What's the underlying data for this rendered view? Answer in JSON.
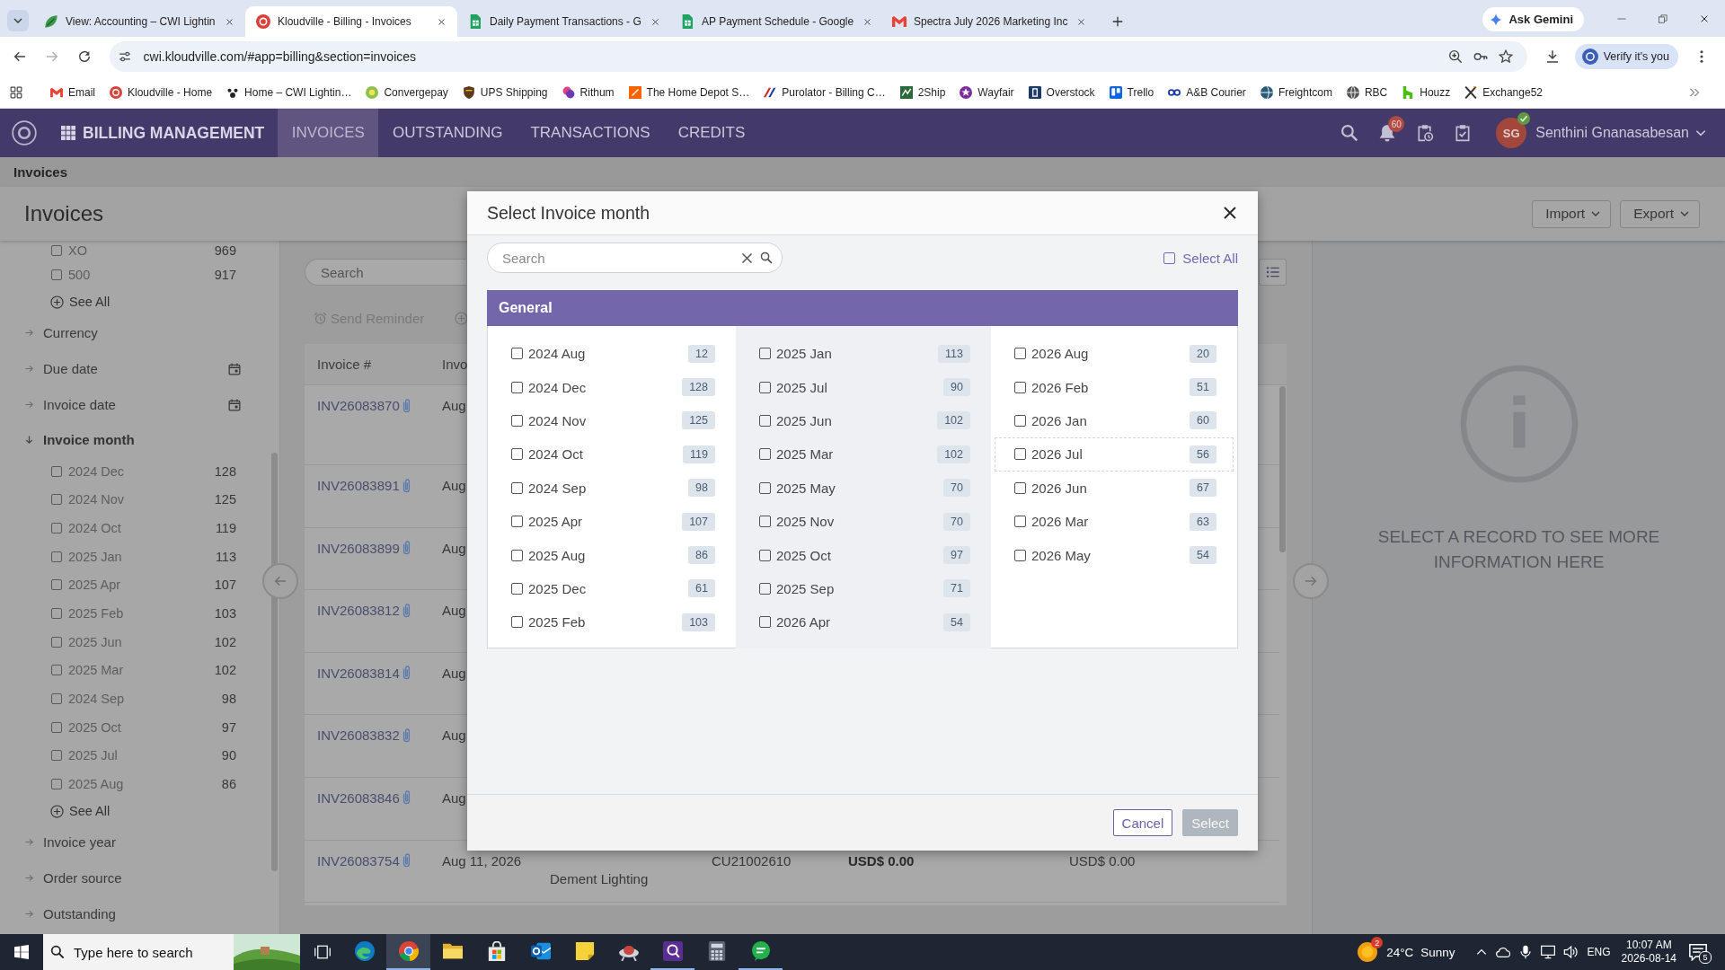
{
  "browser": {
    "tabs": [
      {
        "title": "View: Accounting – CWI Lightin",
        "selected": false
      },
      {
        "title": "Kloudville - Billing - Invoices",
        "selected": true
      },
      {
        "title": "Daily Payment Transactions - G",
        "selected": false
      },
      {
        "title": "AP Payment Schedule - Google",
        "selected": false
      },
      {
        "title": "Spectra July 2026 Marketing Inc",
        "selected": false
      }
    ],
    "gemini": "Ask Gemini",
    "address": "cwi.kloudville.com/#app=billing&section=invoices",
    "profile": "Verify it's you",
    "bookmarks": [
      "Email",
      "Kloudville - Home",
      "Home – CWI Lightin…",
      "Convergepay",
      "UPS Shipping",
      "Rithum",
      "The Home Depot S…",
      "Purolator - Billing C…",
      "2Ship",
      "Wayfair",
      "Overstock",
      "Trello",
      "A&B Courier",
      "Freightcom",
      "RBC",
      "Houzz",
      "Exchange52"
    ]
  },
  "app": {
    "title": "BILLING MANAGEMENT",
    "nav": [
      {
        "label": "INVOICES",
        "selected": true
      },
      {
        "label": "OUTSTANDING",
        "selected": false
      },
      {
        "label": "TRANSACTIONS",
        "selected": false
      },
      {
        "label": "CREDITS",
        "selected": false
      }
    ],
    "notifications": "60",
    "user": {
      "initials": "SG",
      "name": "Senthini Gnanasabesan",
      "verified": true
    }
  },
  "breadcrumb": "Invoices",
  "page_title": "Invoices",
  "actions": [
    "Import",
    "Export"
  ],
  "sidebar": {
    "top_options": [
      {
        "label": "XO",
        "count": "969",
        "checked": false
      },
      {
        "label": "500",
        "count": "917",
        "checked": false
      }
    ],
    "top_see_all": "See All",
    "filters": [
      {
        "label": "Currency",
        "kind": "plain",
        "expanded": false
      },
      {
        "label": "Due date",
        "kind": "date",
        "expanded": false
      },
      {
        "label": "Invoice date",
        "kind": "date",
        "expanded": false
      },
      {
        "label": "Invoice month",
        "kind": "plain",
        "expanded": true,
        "options": [
          {
            "label": "2024 Dec",
            "count": "128",
            "checked": false
          },
          {
            "label": "2024 Nov",
            "count": "125",
            "checked": false
          },
          {
            "label": "2024 Oct",
            "count": "119",
            "checked": false
          },
          {
            "label": "2025 Jan",
            "count": "113",
            "checked": false
          },
          {
            "label": "2025 Apr",
            "count": "107",
            "checked": false
          },
          {
            "label": "2025 Feb",
            "count": "103",
            "checked": false
          },
          {
            "label": "2025 Jun",
            "count": "102",
            "checked": false
          },
          {
            "label": "2025 Mar",
            "count": "102",
            "checked": false
          },
          {
            "label": "2024 Sep",
            "count": "98",
            "checked": false
          },
          {
            "label": "2025 Oct",
            "count": "97",
            "checked": false
          },
          {
            "label": "2025 Jul",
            "count": "90",
            "checked": false
          },
          {
            "label": "2025 Aug",
            "count": "86",
            "checked": false
          }
        ],
        "see_all": "See All"
      },
      {
        "label": "Invoice year",
        "kind": "plain",
        "expanded": false
      },
      {
        "label": "Order source",
        "kind": "plain",
        "expanded": false
      },
      {
        "label": "Outstanding",
        "kind": "plain",
        "expanded": false
      }
    ]
  },
  "toolbar": {
    "search": {
      "placeholder": "Search"
    },
    "send_reminder": {
      "label": "Send Reminder",
      "disabled": true
    }
  },
  "table": {
    "columns": [
      "Invoice #",
      "Invo"
    ],
    "rows": [
      {
        "attachment": true,
        "cells": [
          "INV26083870",
          "Aug"
        ]
      },
      {
        "attachment": true,
        "cells": [
          "INV26083891",
          "Aug"
        ]
      },
      {
        "attachment": true,
        "cells": [
          "INV26083899",
          "Aug"
        ]
      },
      {
        "attachment": true,
        "cells": [
          "INV26083812",
          "Aug"
        ]
      },
      {
        "attachment": true,
        "cells": [
          "INV26083814",
          "Aug"
        ]
      },
      {
        "attachment": true,
        "cells": [
          "INV26083832",
          "Aug"
        ]
      },
      {
        "attachment": true,
        "cells": [
          "INV26083846",
          "Aug"
        ]
      },
      {
        "attachment": true,
        "cells": [
          "INV26083754",
          "Aug 11, 2026",
          "Dement Lighting",
          "CU21002610",
          "USD$ 0.00",
          "USD$ 0.00"
        ]
      }
    ]
  },
  "detail_panel": {
    "message": "SELECT A RECORD TO SEE MORE INFORMATION HERE"
  },
  "modal": {
    "title": "Select Invoice month",
    "search": {
      "placeholder": "Search"
    },
    "select_all": {
      "label": "Select All",
      "checked": false
    },
    "group": "General",
    "columns": [
      {
        "options": [
          {
            "label": "2024 Aug",
            "count": "12",
            "checked": false,
            "focused": false
          },
          {
            "label": "2024 Dec",
            "count": "128",
            "checked": false,
            "focused": false
          },
          {
            "label": "2024 Nov",
            "count": "125",
            "checked": false,
            "focused": false
          },
          {
            "label": "2024 Oct",
            "count": "119",
            "checked": false,
            "focused": false
          },
          {
            "label": "2024 Sep",
            "count": "98",
            "checked": false,
            "focused": false
          },
          {
            "label": "2025 Apr",
            "count": "107",
            "checked": false,
            "focused": false
          },
          {
            "label": "2025 Aug",
            "count": "86",
            "checked": false,
            "focused": false
          },
          {
            "label": "2025 Dec",
            "count": "61",
            "checked": false,
            "focused": false
          },
          {
            "label": "2025 Feb",
            "count": "103",
            "checked": false,
            "focused": false
          }
        ]
      },
      {
        "options": [
          {
            "label": "2025 Jan",
            "count": "113",
            "checked": false,
            "focused": false
          },
          {
            "label": "2025 Jul",
            "count": "90",
            "checked": false,
            "focused": false
          },
          {
            "label": "2025 Jun",
            "count": "102",
            "checked": false,
            "focused": false
          },
          {
            "label": "2025 Mar",
            "count": "102",
            "checked": false,
            "focused": false
          },
          {
            "label": "2025 May",
            "count": "70",
            "checked": false,
            "focused": false
          },
          {
            "label": "2025 Nov",
            "count": "70",
            "checked": false,
            "focused": false
          },
          {
            "label": "2025 Oct",
            "count": "97",
            "checked": false,
            "focused": false
          },
          {
            "label": "2025 Sep",
            "count": "71",
            "checked": false,
            "focused": false
          },
          {
            "label": "2026 Apr",
            "count": "54",
            "checked": false,
            "focused": false
          }
        ]
      },
      {
        "options": [
          {
            "label": "2026 Aug",
            "count": "20",
            "checked": false,
            "focused": false
          },
          {
            "label": "2026 Feb",
            "count": "51",
            "checked": false,
            "focused": false
          },
          {
            "label": "2026 Jan",
            "count": "60",
            "checked": false,
            "focused": false
          },
          {
            "label": "2026 Jul",
            "count": "56",
            "checked": false,
            "focused": true
          },
          {
            "label": "2026 Jun",
            "count": "67",
            "checked": false,
            "focused": false
          },
          {
            "label": "2026 Mar",
            "count": "63",
            "checked": false,
            "focused": false
          },
          {
            "label": "2026 May",
            "count": "54",
            "checked": false,
            "focused": false
          }
        ]
      }
    ],
    "buttons": [
      {
        "label": "Cancel",
        "kind": "secondary",
        "disabled": false
      },
      {
        "label": "Select",
        "kind": "primary",
        "disabled": true
      }
    ]
  },
  "taskbar": {
    "search": {
      "placeholder": "Type here to search"
    },
    "apps": [
      {
        "kind": "edge",
        "running": false,
        "selected": false
      },
      {
        "kind": "chrome",
        "running": true,
        "selected": true
      },
      {
        "kind": "explorer",
        "running": false,
        "selected": false
      },
      {
        "kind": "store",
        "running": false,
        "selected": false
      },
      {
        "kind": "outlook",
        "running": false,
        "selected": false
      },
      {
        "kind": "notes",
        "running": false,
        "selected": false
      },
      {
        "kind": "dish",
        "running": false,
        "selected": false
      },
      {
        "kind": "terminal",
        "running": true,
        "selected": false
      },
      {
        "kind": "calculator",
        "running": false,
        "selected": false
      },
      {
        "kind": "chat",
        "running": true,
        "selected": false
      }
    ],
    "weather": {
      "badge": "2",
      "temperature": "24°C",
      "condition": "Sunny"
    },
    "language": "ENG",
    "time": "10:07 AM",
    "date": "2026-08-14",
    "notifications": "5"
  }
}
